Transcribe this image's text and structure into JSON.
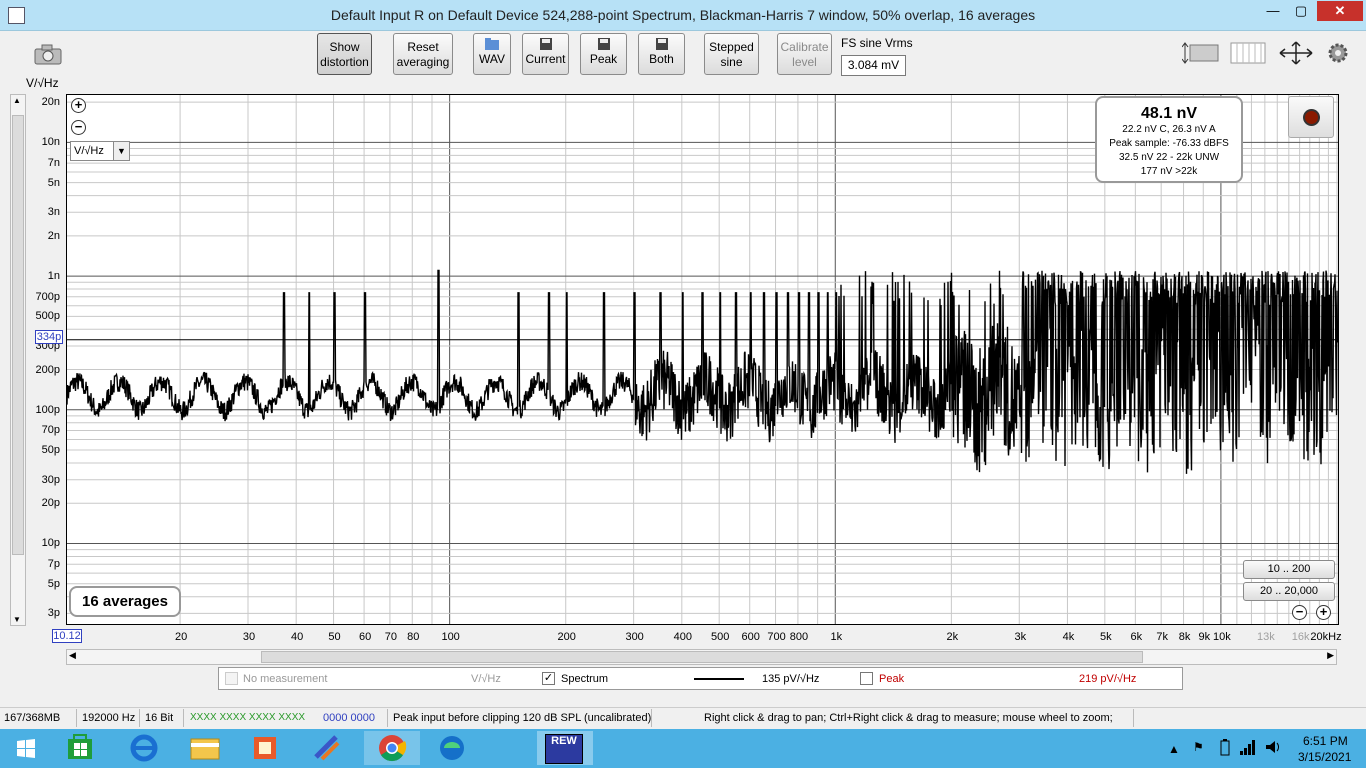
{
  "window": {
    "title": "Default Input R on Default Device 524,288-point Spectrum, Blackman-Harris 7 window, 50% overlap, 16 averages",
    "minimize": "—",
    "maximize": "▢",
    "close": "✕"
  },
  "toolbar": {
    "show_distortion": "Show\ndistortion",
    "reset_averaging": "Reset\naveraging",
    "wav": "WAV",
    "current": "Current",
    "peak": "Peak",
    "both": "Both",
    "stepped_sine": "Stepped\nsine",
    "calibrate_level": "Calibrate\nlevel",
    "fs_sine_label": "FS sine Vrms",
    "fs_sine_value": "3.084 mV"
  },
  "plot": {
    "y_unit_label": "V/√Hz",
    "y_unit_select": "V/√Hz",
    "y_ticks": [
      "20n",
      "10n",
      "7n",
      "5n",
      "3n",
      "2n",
      "1n",
      "700p",
      "500p",
      "300p",
      "200p",
      "100p",
      "70p",
      "50p",
      "30p",
      "20p",
      "10p",
      "7p",
      "5p",
      "3p"
    ],
    "cursor_y_value": "334p",
    "x_min_value": "10.12",
    "x_ticks": [
      "20",
      "30",
      "40",
      "50",
      "60",
      "70",
      "80",
      "100",
      "200",
      "300",
      "400",
      "500",
      "600",
      "700",
      "800",
      "1k",
      "2k",
      "3k",
      "4k",
      "5k",
      "6k",
      "7k",
      "8k",
      "9k",
      "10k",
      "13k",
      "16k",
      "20kHz"
    ],
    "x_ticks_faded": [
      "13k",
      "16k"
    ],
    "averages_label": "16 averages",
    "info": {
      "headline": "48.1 nV",
      "line1": "22.2 nV C, 26.3 nV A",
      "line2": "Peak sample: -76.33 dBFS",
      "line3": "32.5 nV 22 - 22k UNW",
      "line4": "177 nV >22k"
    },
    "range_buttons": [
      "10 .. 200",
      "20 .. 20,000"
    ],
    "zoom_in": "+",
    "zoom_out": "−"
  },
  "legend": {
    "no_measurement": "No measurement",
    "no_measurement_unit": "V/√Hz",
    "spectrum_label": "Spectrum",
    "spectrum_checked": true,
    "spectrum_value": "135 pV/√Hz",
    "peak_label": "Peak",
    "peak_value": "219 pV/√Hz",
    "peak_color": "#c00000"
  },
  "status": {
    "memory": "167/368MB",
    "rate": "192000 Hz",
    "bits": "16 Bit",
    "levels_green": "XXXX XXXX  XXXX XXXX",
    "levels_blue": "0000 0000",
    "clip": "Peak input before clipping 120 dB SPL (uncalibrated)",
    "hint": "Right click & drag to pan; Ctrl+Right click & drag to measure; mouse wheel to zoom;"
  },
  "taskbar": {
    "rew_label": "REW",
    "time": "6:51 PM",
    "date": "3/15/2021"
  },
  "colors": {
    "titlebar": "#b7e1f6",
    "taskbar": "#4bb0e3",
    "trace": "#000000",
    "accent_blue": "#3040c0"
  }
}
